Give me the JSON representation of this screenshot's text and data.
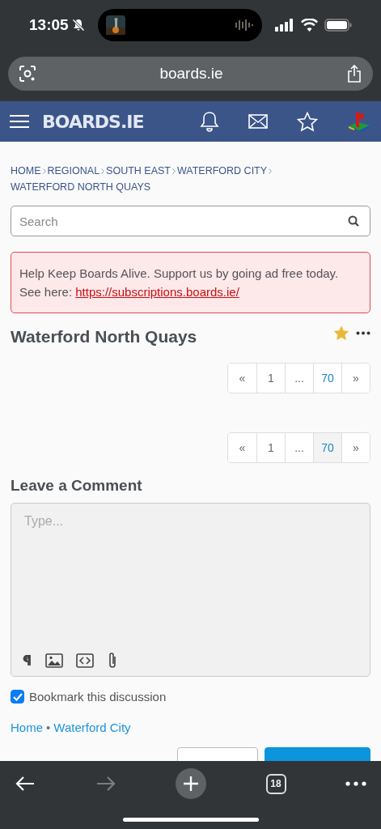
{
  "status_bar": {
    "time": "13:05"
  },
  "browser": {
    "url": "boards.ie",
    "tab_count": "18"
  },
  "breadcrumbs": [
    "HOME",
    "REGIONAL",
    "SOUTH EAST",
    "WATERFORD CITY",
    "WATERFORD NORTH QUAYS"
  ],
  "search": {
    "placeholder": "Search"
  },
  "alert": {
    "text": "Help Keep Boards Alive. Support us by going ad free today. See here:",
    "link": "https://subscriptions.boards.ie/"
  },
  "logo": "BOARDS.IE",
  "discussion": {
    "title": "Waterford North Quays",
    "bookmarked": true
  },
  "pagers": [
    {
      "items": [
        {
          "label": "«",
          "selected": false
        },
        {
          "label": "1",
          "selected": false
        },
        {
          "label": "...",
          "selected": false
        },
        {
          "label": "70",
          "selected": false
        },
        {
          "label": "»",
          "selected": false
        }
      ]
    },
    {
      "items": [
        {
          "label": "«",
          "selected": false
        },
        {
          "label": "1",
          "selected": false
        },
        {
          "label": "...",
          "selected": false
        },
        {
          "label": "70",
          "selected": true
        },
        {
          "label": "»",
          "selected": false
        }
      ]
    }
  ],
  "comment": {
    "heading": "Leave a Comment",
    "placeholder": "Type..."
  },
  "bookmark_option": {
    "label": "Bookmark this discussion",
    "checked": true
  },
  "footer_crumbs": {
    "items": [
      "Home",
      "Waterford City"
    ],
    "separator": "•"
  },
  "form_buttons": [
    {
      "kind": "secondary"
    },
    {
      "kind": "primary"
    }
  ]
}
